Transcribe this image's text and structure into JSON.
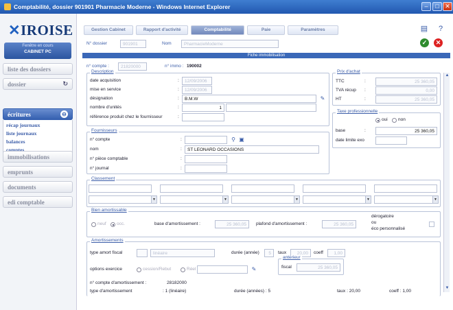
{
  "window": {
    "title": "Comptabilité, dossier 901901 Pharmacie Moderne - Windows Internet Explorer"
  },
  "app": {
    "logo": "IROISE",
    "current_label": "Fenêtre en cours",
    "current_value": "CABINET PC"
  },
  "sidebar": {
    "items": [
      {
        "label": "liste des dossiers"
      },
      {
        "label": "dossier"
      },
      {
        "label": "écritures"
      },
      {
        "label": "immobilisations"
      },
      {
        "label": "emprunts"
      },
      {
        "label": "documents"
      },
      {
        "label": "edi comptable"
      }
    ],
    "sub": [
      "récap journaux",
      "liste journaux",
      "balances",
      "comptes"
    ]
  },
  "tabs": [
    "Gestion Cabinet",
    "Rapport d'activité",
    "Comptabilité",
    "Paie",
    "Paramètres"
  ],
  "header": {
    "dossier_label": "N° dossier",
    "dossier_value": "901901",
    "nom_label": "Nom",
    "nom_value": "PharmacieModerne",
    "banner": "Fiche immobilisation"
  },
  "compte_row": {
    "compte_label": "n° compte :",
    "compte_value": "21820000",
    "immo_label": "n° immo :",
    "immo_value": "190002"
  },
  "description": {
    "legend": "Description",
    "fields": [
      {
        "label": "date acquisition",
        "value": "12/09/2006"
      },
      {
        "label": "mise en service",
        "value": "12/09/2006"
      },
      {
        "label": "désignation",
        "value": "B.M.W"
      },
      {
        "label": "nombre d'unités",
        "value": "1"
      },
      {
        "label": "référence produit chez le fournisseur",
        "value": ""
      }
    ]
  },
  "prix": {
    "legend": "Prix d'achat",
    "fields": [
      {
        "label": "TTC",
        "value": "25 360,05"
      },
      {
        "label": "TVA récup",
        "value": "0,00"
      },
      {
        "label": "HT",
        "value": "25 360,05"
      }
    ]
  },
  "taxe": {
    "legend": "Taxe professionnelle",
    "oui": "oui",
    "non": "non",
    "base_label": "base",
    "base_value": "25 360,05",
    "date_label": "date limite exo"
  },
  "fournisseur": {
    "legend": "Fournisseurs",
    "fields": [
      {
        "label": "n° compte",
        "value": ""
      },
      {
        "label": "nom",
        "value": "ST LEONARD OCCASIONS"
      },
      {
        "label": "n° pièce comptable",
        "value": ""
      },
      {
        "label": "n° journal",
        "value": ""
      }
    ]
  },
  "classement": {
    "legend": "Classement"
  },
  "bien": {
    "legend": "Bien amortissable",
    "opt1": "neuf",
    "opt2": "occ.",
    "base_label": "base d'amortissement :",
    "base_value": "25 360,05",
    "plafond_label": "plafond d'amortissement :",
    "plafond_value": "25 360,05",
    "derog_l1": "dérogatoire",
    "derog_l2": "ou",
    "derog_l3": "éco personnalisé"
  },
  "amort": {
    "legend": "Amortissements",
    "type_label": "type amort fiscal",
    "type_value": "linéaire",
    "duree_label": "durée (année)",
    "duree_value": "5",
    "taux_label": "taux",
    "taux_value": "20,00",
    "coeff_label": "coeff",
    "coeff_value": "1,00",
    "options_label": "options exercice",
    "opt_a": "cession/Rebut",
    "opt_b": "Réel",
    "anterieur_legend": "antérieur",
    "fiscal_label": "fiscal",
    "fiscal_value": "25 360,05",
    "compte_label": "n° compte d'amortissement :",
    "compte_value": "28182000",
    "last_type_label": "type d'amortissement",
    "last_type_value": ": 1 (linéaire)",
    "last_duree": "durée (années) : 5",
    "last_taux": "taux : 20,00",
    "last_coeff": "coeff : 1,00"
  }
}
